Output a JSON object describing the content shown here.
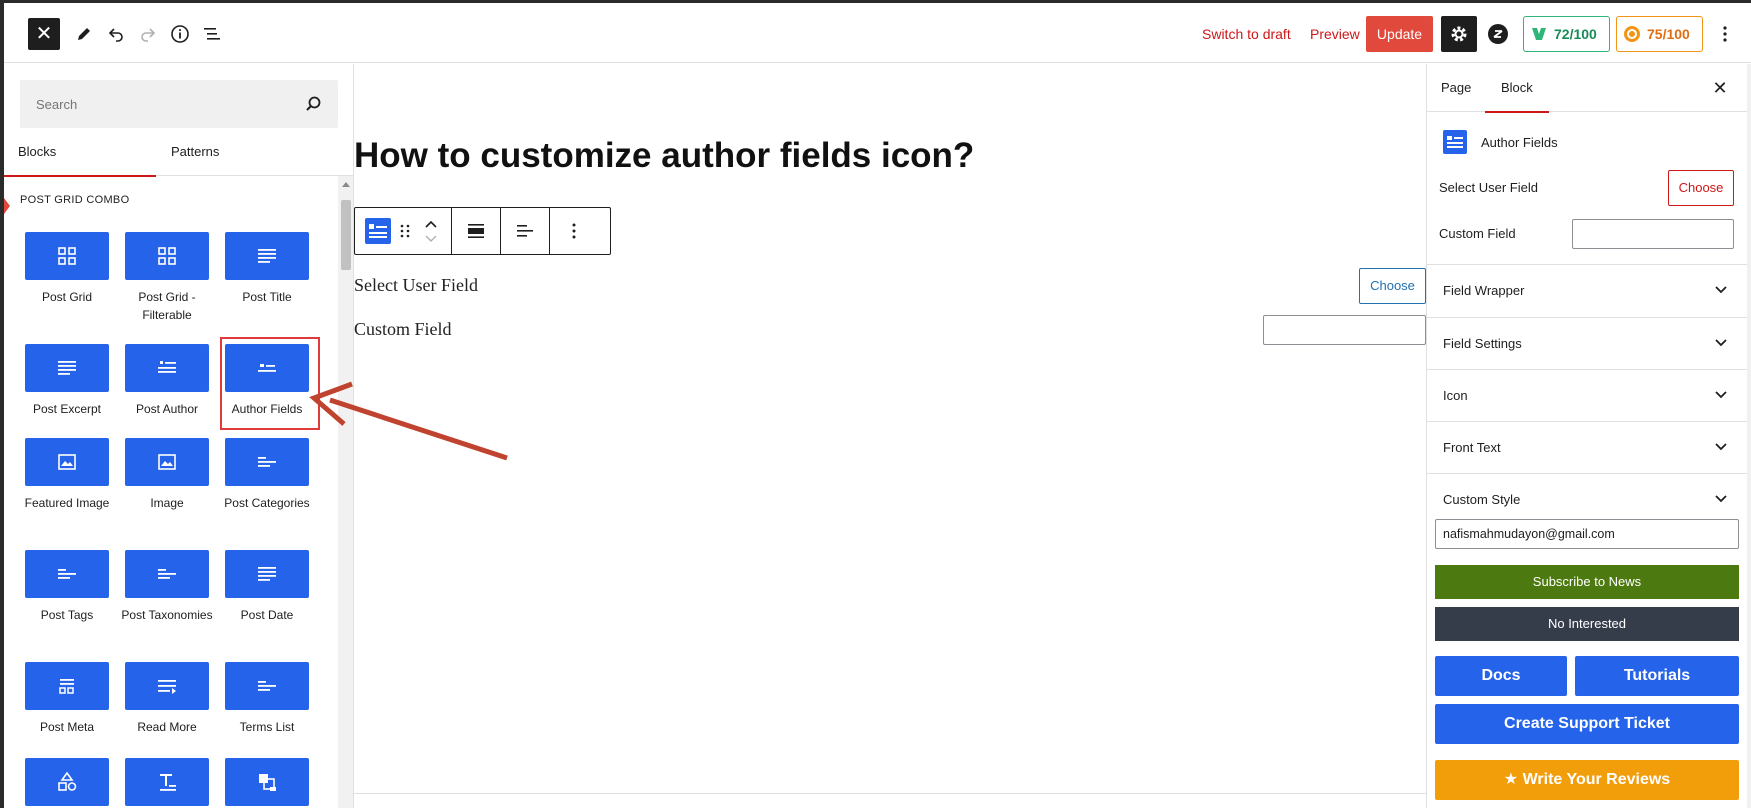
{
  "topbar": {
    "close_symbol": "✕",
    "switch_to_draft": "Switch to draft",
    "preview": "Preview",
    "update": "Update",
    "seo_score": "72/100",
    "readability_score": "75/100",
    "icons": [
      "close-icon",
      "pencil-icon",
      "undo-icon",
      "redo-icon",
      "info-icon",
      "list-view-icon",
      "gear-icon",
      "plugin-logo-icon",
      "seo-score-icon",
      "readability-score-icon",
      "more-vertical-icon"
    ]
  },
  "inserter": {
    "search_placeholder": "Search",
    "tabs": [
      "Blocks",
      "Patterns"
    ],
    "active_tab": "Blocks",
    "category": "POST GRID COMBO",
    "blocks": [
      {
        "label": "Post Grid",
        "icon": "grid"
      },
      {
        "label": "Post Grid - Filterable",
        "icon": "grid"
      },
      {
        "label": "Post Title",
        "icon": "lines"
      },
      {
        "label": "Post Excerpt",
        "icon": "lines"
      },
      {
        "label": "Post Author",
        "icon": "list"
      },
      {
        "label": "Author Fields",
        "icon": "author"
      },
      {
        "label": "Featured Image",
        "icon": "image"
      },
      {
        "label": "Image",
        "icon": "image"
      },
      {
        "label": "Post Categories",
        "icon": "short-lines"
      },
      {
        "label": "Post Tags",
        "icon": "short-lines"
      },
      {
        "label": "Post Taxonomies",
        "icon": "short-lines"
      },
      {
        "label": "Post Date",
        "icon": "lines"
      },
      {
        "label": "Post Meta",
        "icon": "meta"
      },
      {
        "label": "Read More",
        "icon": "readmore"
      },
      {
        "label": "Terms List",
        "icon": "short-lines"
      },
      {
        "label": "",
        "icon": "shapes"
      },
      {
        "label": "",
        "icon": "text"
      },
      {
        "label": "",
        "icon": "stack"
      }
    ],
    "highlighted_block": "Author Fields",
    "accent_color": "#2563eb"
  },
  "canvas": {
    "post_title": "How to customize author fields icon?",
    "select_user_field": "Select User Field",
    "choose": "Choose",
    "custom_field": "Custom Field"
  },
  "sidebar": {
    "tabs": [
      "Page",
      "Block"
    ],
    "active_tab": "Block",
    "close_symbol": "✕",
    "block_name": "Author Fields",
    "select_user_field": "Select User Field",
    "choose": "Choose",
    "custom_field": "Custom Field",
    "panels": [
      "Field Wrapper",
      "Field Settings",
      "Icon",
      "Front Text",
      "Custom Style"
    ],
    "email_value": "nafismahmudayon@gmail.com",
    "subscribe": "Subscribe to News",
    "no_interested": "No Interested",
    "docs": "Docs",
    "tutorials": "Tutorials",
    "support": "Create Support Ticket",
    "reviews": "Write Your Reviews",
    "colors": {
      "subscribe": "#4d7a10",
      "no_interested": "#363d4a",
      "blue": "#2563eb",
      "reviews": "#f29d0a"
    }
  }
}
